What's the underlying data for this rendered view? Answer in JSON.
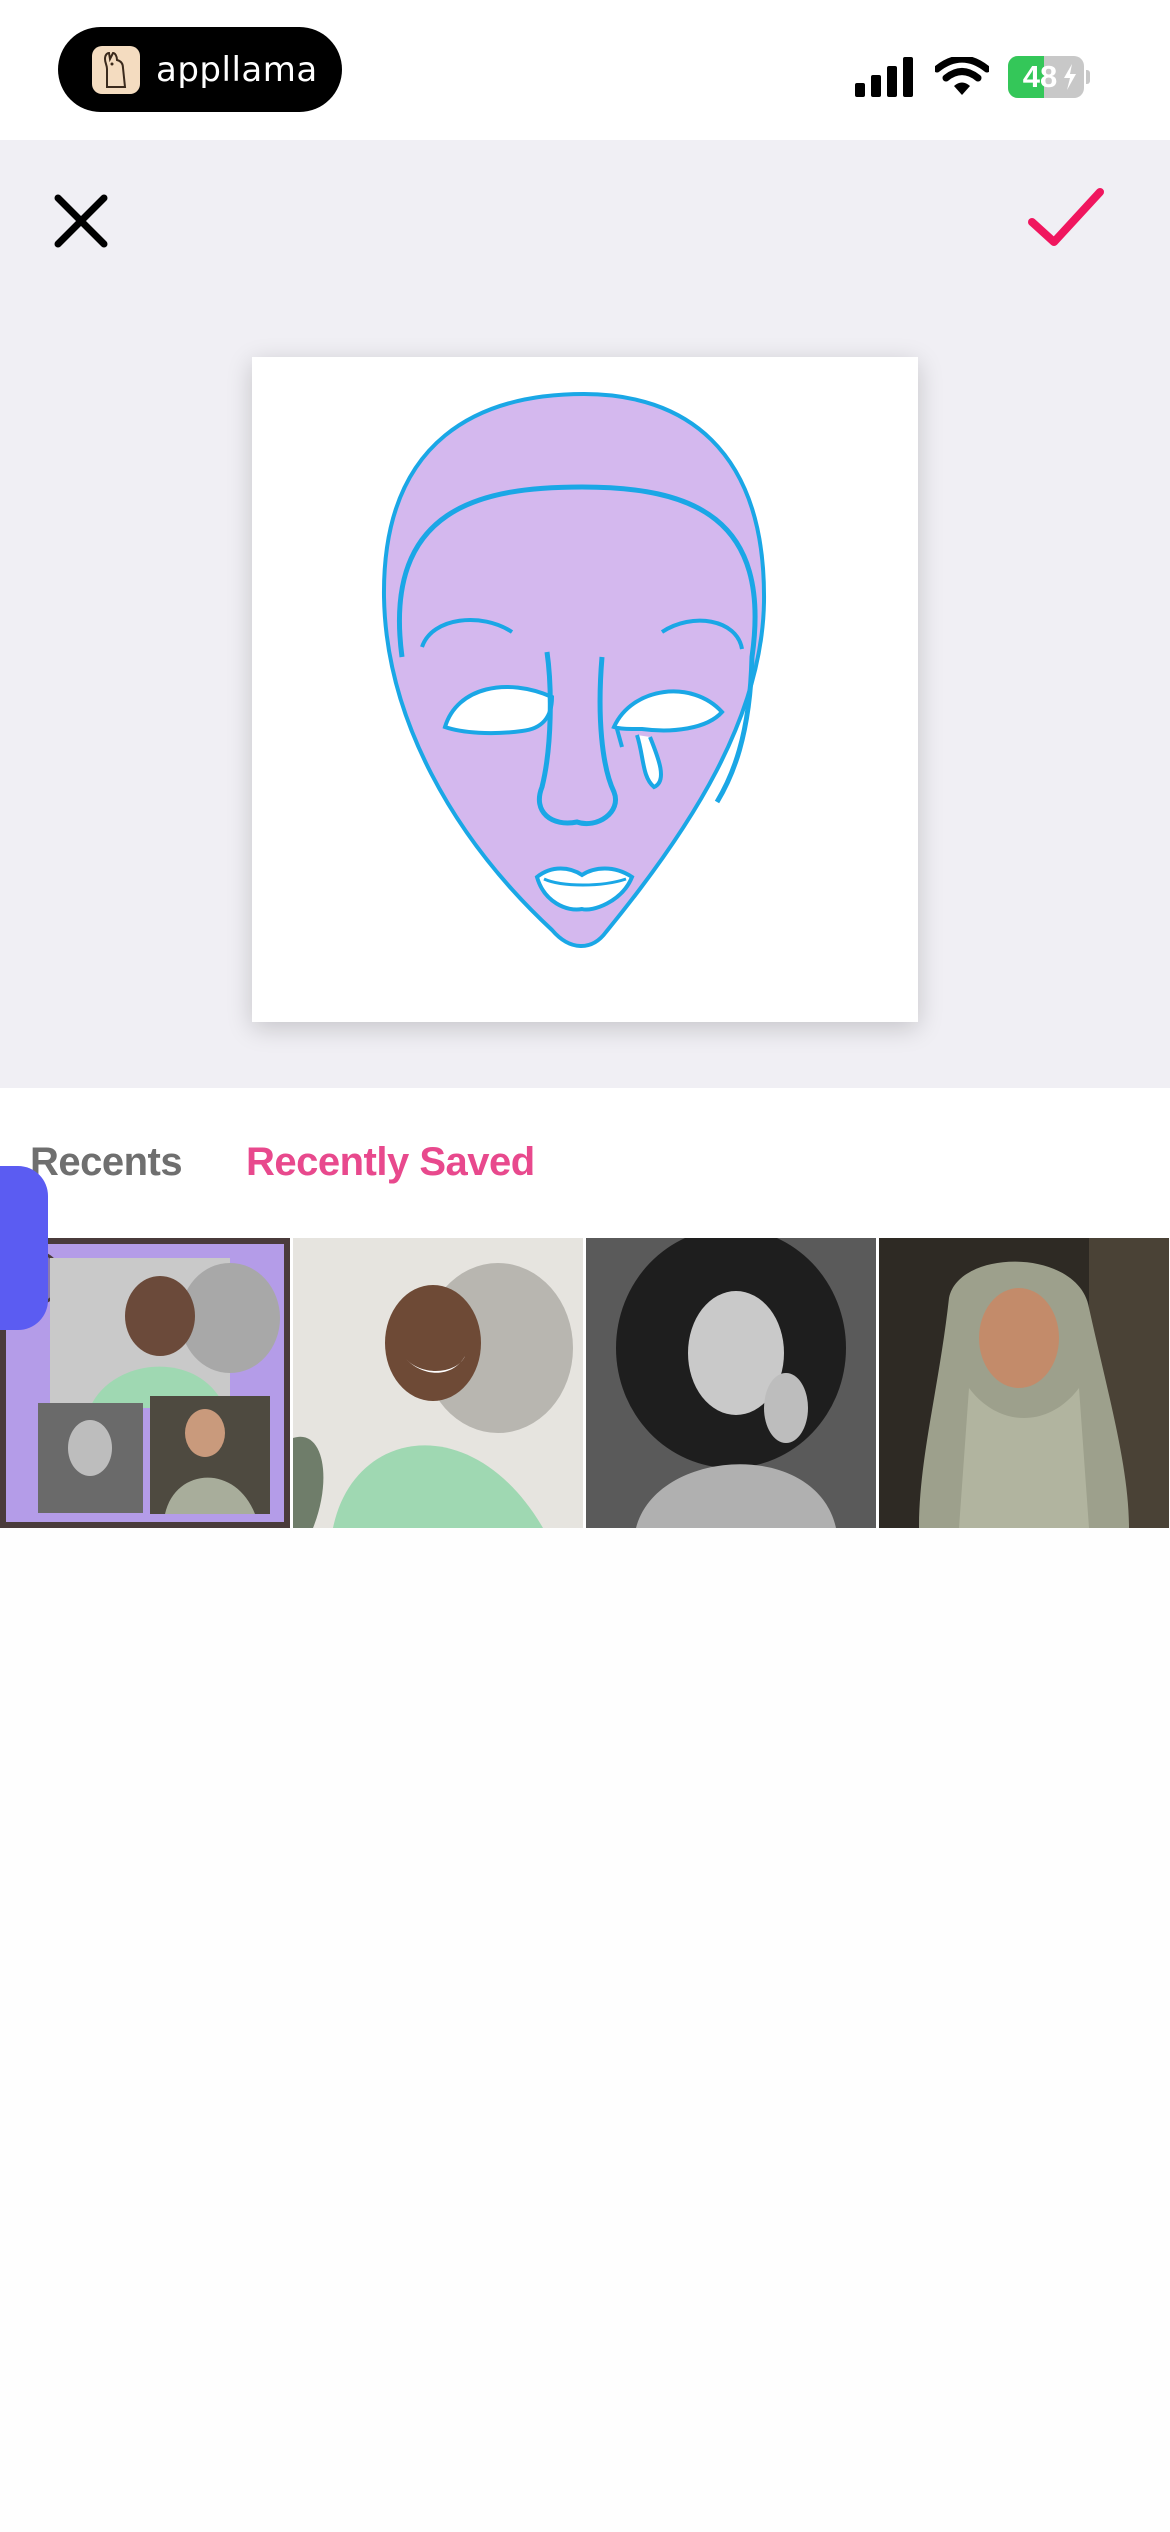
{
  "status_bar": {
    "app_name": "appllama",
    "battery_level": 48,
    "battery_text": "48",
    "charging": true
  },
  "toolbar": {
    "close_icon": "close-icon",
    "confirm_icon": "checkmark-icon",
    "confirm_color": "#f0165e"
  },
  "tabs": [
    {
      "label": "Recents",
      "active": false
    },
    {
      "label": "Recently Saved",
      "active": true
    }
  ],
  "colors": {
    "accent": "#e8498d",
    "side_handle": "#5b5cf2",
    "mask_fill": "#d4b8ee",
    "mask_stroke": "#1aa7e6"
  },
  "thumbnails": [
    {
      "name": "collage-thumbnail"
    },
    {
      "name": "smiling-woman-photo"
    },
    {
      "name": "curly-hair-woman-photo"
    },
    {
      "name": "hijab-woman-photo"
    }
  ]
}
